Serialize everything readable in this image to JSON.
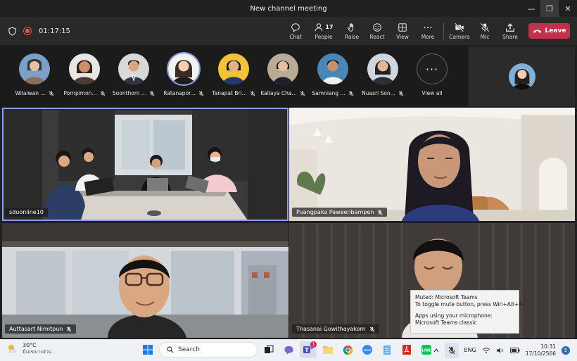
{
  "window": {
    "title": "New channel meeting",
    "controls": [
      "—",
      "❐",
      "✕"
    ]
  },
  "toolbar": {
    "timer": "01:17:15",
    "chat_label": "Chat",
    "people_label": "People",
    "people_count": "17",
    "raise_label": "Raise",
    "react_label": "React",
    "view_label": "View",
    "more_label": "More",
    "camera_label": "Camera",
    "mic_label": "Mic",
    "share_label": "Share",
    "leave_label": "Leave"
  },
  "participants": [
    {
      "name": "Wilaiwan ...",
      "color": "#8a6d5a"
    },
    {
      "name": "Pornpimon...",
      "color": "#4a3c34"
    },
    {
      "name": "Soonthorn ...",
      "color": "#2e3440"
    },
    {
      "name": "Ratanapor...",
      "color": "#d9d2cc"
    },
    {
      "name": "Tanapat Bri...",
      "color": "#1e3a6b"
    },
    {
      "name": "Kallaya Cha...",
      "color": "#b9ab94"
    },
    {
      "name": "Samniang ...",
      "color": "#3b4d60"
    },
    {
      "name": "Nuasri Son...",
      "color": "#6d7b8a"
    }
  ],
  "view_all_label": "View all",
  "tiles": [
    {
      "name": "sduonline10"
    },
    {
      "name": "Puangpaka Paweenbampen"
    },
    {
      "name": "Auttasart Nimitpun"
    },
    {
      "name": "Thasanai Gowithayakorn"
    }
  ],
  "tooltip": {
    "line1": "Muted: Microsoft Teams",
    "line2": "To toggle mute button, press Win+Alt+K.",
    "line3": "Apps using your microphone:",
    "line4": "Microsoft Teams classic"
  },
  "taskbar": {
    "temp": "30°C",
    "condition": "มีเมฆบางส่วน",
    "search_placeholder": "Search",
    "lang": "ENG",
    "time": "10:31",
    "date": "17/10/2566",
    "teams_badge": "1",
    "notif_count": "5"
  }
}
